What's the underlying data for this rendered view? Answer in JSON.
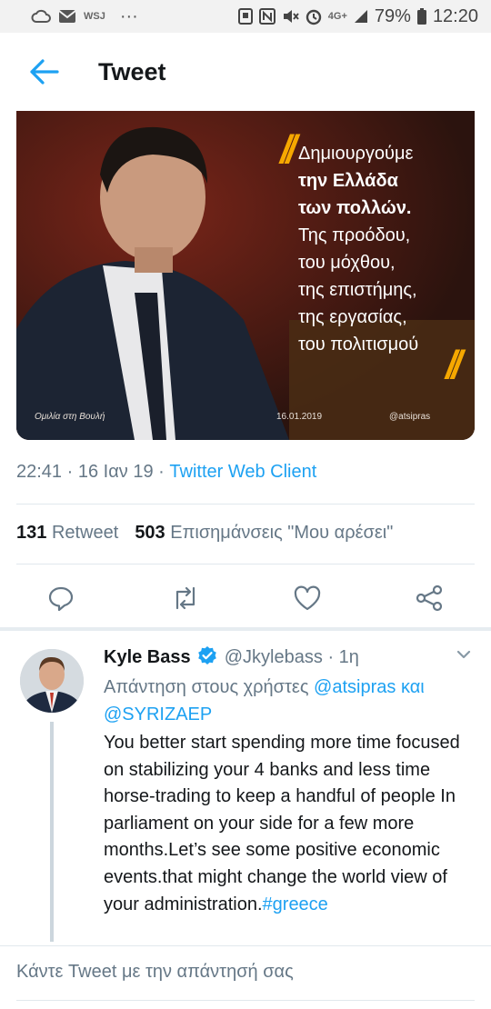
{
  "status_bar": {
    "left_label": "WSJ",
    "more": "···",
    "network": "4G+",
    "battery": "79%",
    "time": "12:20"
  },
  "header": {
    "title": "Tweet",
    "back_icon": "arrow-left-icon"
  },
  "tweet_image": {
    "quote_open": "\"",
    "quote_lines": [
      {
        "text": "Δημιουργούμε",
        "bold": false
      },
      {
        "text": "την Ελλάδα",
        "bold": true
      },
      {
        "text": "των πολλών.",
        "bold": true
      },
      {
        "text": "Της προόδου,",
        "bold": false
      },
      {
        "text": "του μόχθου,",
        "bold": false
      },
      {
        "text": "της επιστήμης,",
        "bold": false
      },
      {
        "text": "της εργασίας,",
        "bold": false
      },
      {
        "text": "του πολιτισμού",
        "bold": false
      }
    ],
    "quote_close": "\"",
    "caption_left": "Ομιλία στη Βουλή",
    "caption_date": "16.01.2019",
    "caption_handle": "@atsipras"
  },
  "tweet_meta": {
    "time": "22:41",
    "separator": "·",
    "date": "16 Ιαν 19",
    "client": "Twitter Web Client"
  },
  "stats": {
    "retweets_count": "131",
    "retweets_label": "Retweet",
    "likes_count": "503",
    "likes_label": "Επισημάνσεις \"Μου αρέσει\""
  },
  "actions": {
    "reply_icon": "reply-icon",
    "retweet_icon": "retweet-icon",
    "like_icon": "heart-icon",
    "share_icon": "share-icon"
  },
  "reply": {
    "name": "Kyle Bass",
    "handle": "@Jkylebass",
    "separator": "·",
    "age": "1η",
    "reply_to_prefix": "Απάντηση στους χρήστες",
    "mention_1": "@atsipras",
    "conjunction": "και",
    "mention_2": "@SYRIZAEP",
    "text": "You better start spending more time focused on stabilizing your 4 banks and less time horse-trading to keep a handful of people In parliament on your side for a few more months.Let’s see some positive economic events.that might change the world view of your administration.",
    "hashtag": "#greece"
  },
  "compose": {
    "placeholder": "Κάντε Tweet με την απάντησή σας"
  },
  "colors": {
    "accent": "#1da1f2",
    "text": "#14171a",
    "secondary": "#657786",
    "quote": "#f6a800"
  }
}
